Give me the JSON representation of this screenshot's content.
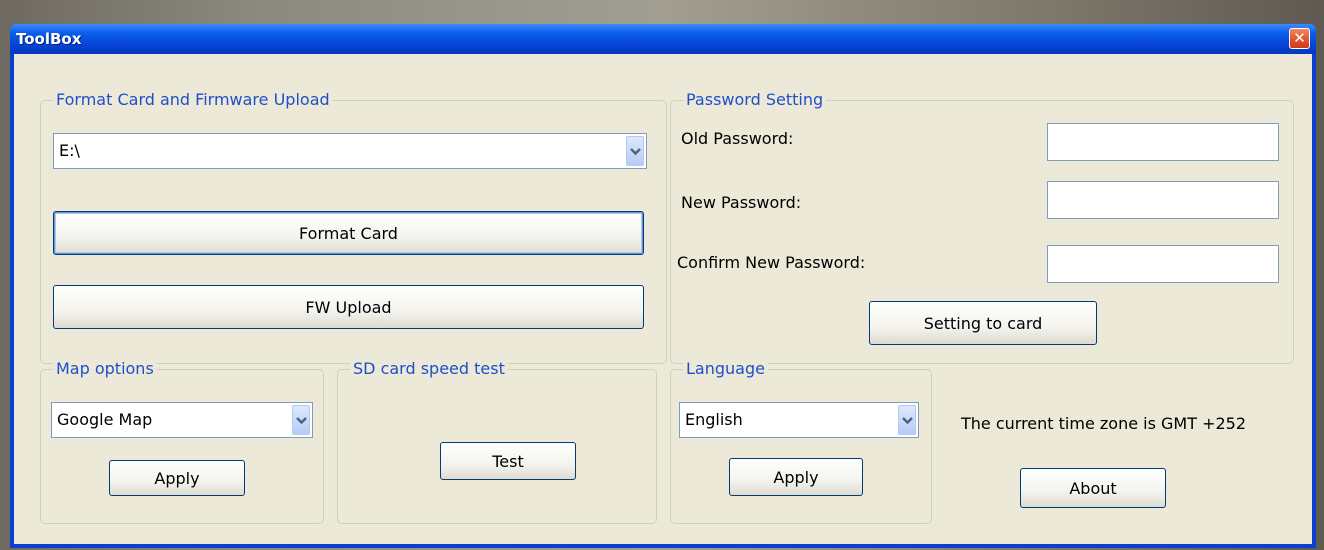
{
  "window": {
    "title": "ToolBox"
  },
  "format_group": {
    "legend": "Format Card and Firmware Upload",
    "drive_value": "E:\\",
    "format_label": "Format Card",
    "fw_label": "FW Upload"
  },
  "password_group": {
    "legend": "Password Setting",
    "old_label": "Old Password:",
    "new_label": "New Password:",
    "confirm_label": "Confirm New Password:",
    "old_value": "",
    "new_value": "",
    "confirm_value": "",
    "set_label": "Setting to card"
  },
  "map_group": {
    "legend": "Map options",
    "selected": "Google Map",
    "apply_label": "Apply"
  },
  "sd_group": {
    "legend": "SD card speed test",
    "test_label": "Test"
  },
  "language_group": {
    "legend": "Language",
    "selected": "English",
    "apply_label": "Apply"
  },
  "timezone_text": "The current time zone is GMT +252",
  "about_label": "About"
}
